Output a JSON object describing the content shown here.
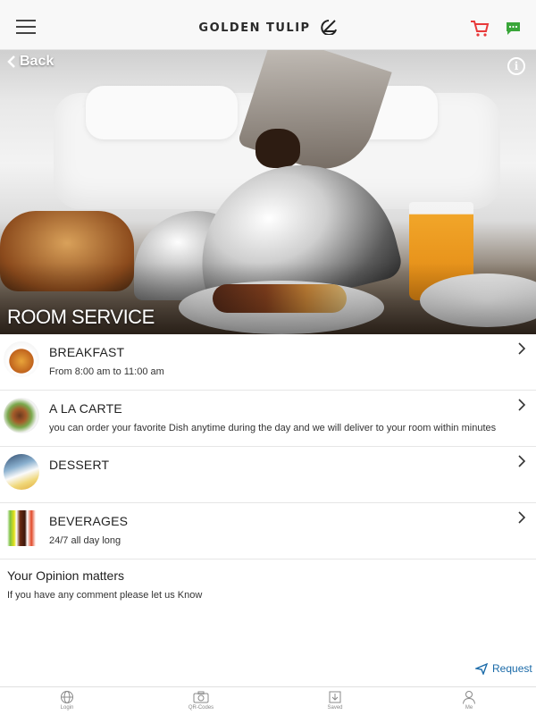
{
  "app": {
    "brand_name": "GOLDEN TULIP",
    "brand_logo": "tulip-logo-icon",
    "icons": {
      "menu": "hamburger-menu-icon",
      "cart": "shopping-cart-icon",
      "chat": "chat-icon"
    },
    "colors": {
      "cart": "#e8393a",
      "chat": "#3aa63a",
      "link": "#1a6aa8"
    }
  },
  "hero": {
    "back_label": "Back",
    "info_icon": "info-icon",
    "title": "ROOM SERVICE"
  },
  "menu": {
    "items": [
      {
        "title": "BREAKFAST",
        "subtitle": "From 8:00 am to 11:00 am",
        "icon": "breakfast-thumbnail"
      },
      {
        "title": "A LA CARTE",
        "subtitle": "you can order your favorite Dish anytime during the day and we will deliver to your room within minutes",
        "icon": "a-la-carte-thumbnail"
      },
      {
        "title": "DESSERT",
        "subtitle": "",
        "icon": "dessert-thumbnail"
      },
      {
        "title": "BEVERAGES",
        "subtitle": "24/7 all day long",
        "icon": "beverages-thumbnail"
      }
    ]
  },
  "opinion": {
    "title": "Your Opinion matters",
    "subtitle": "If you have any comment please let us Know",
    "request_label": "Request"
  },
  "tabbar": {
    "tabs": [
      {
        "label": "Login",
        "icon": "globe-icon"
      },
      {
        "label": "QR-Codes",
        "icon": "camera-icon"
      },
      {
        "label": "Saved",
        "icon": "download-icon"
      },
      {
        "label": "Me",
        "icon": "person-icon"
      }
    ]
  }
}
